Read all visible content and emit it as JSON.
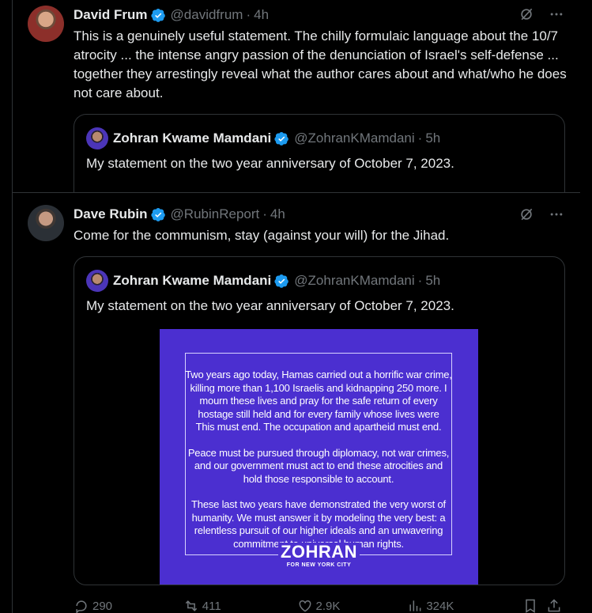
{
  "posts": [
    {
      "author": "David Frum",
      "handle": "@davidfrum",
      "time": "4h",
      "text": "This is a genuinely useful statement. The chilly formulaic language about the 10/7 atrocity ... the intense angry passion of the denunciation of Israel's self-defense ... together they arrestingly reveal what the author cares about and what/who he does not care about.",
      "quote": {
        "author": "Zohran Kwame Mamdani",
        "handle": "@ZohranKMamdani",
        "time": "5h",
        "text": "My statement on the two year anniversary of October 7, 2023."
      }
    },
    {
      "author": "Dave Rubin",
      "handle": "@RubinReport",
      "time": "4h",
      "text": "Come for the communism, stay (against your will) for the Jihad.",
      "quote": {
        "author": "Zohran Kwame Mamdani",
        "handle": "@ZohranKMamdani",
        "time": "5h",
        "text": "My statement on the two year anniversary of October 7, 2023.",
        "media": {
          "paragraph1": "Two years ago today, Hamas carried out a horrific war crime, killing more than 1,100 Israelis and kidnapping 250 more. I mourn these lives and pray for the safe return of every hostage still held and for every family whose lives were",
          "overlap_line": "This must end. The occupation and apartheid must end.",
          "paragraph2": "Peace must be pursued through diplomacy, not war crimes, and our government must act to end these atrocities and hold those responsible to account.",
          "paragraph3": "These last two years have demonstrated the very worst of humanity. We must answer it by modeling the very best: a relentless pursuit of our higher ideals and an unwavering commitment to universal human rights.",
          "logo_word": "ZOHRAN",
          "logo_sub": "FOR NEW YORK CITY",
          "background": "#4b2fd0"
        }
      },
      "stats": {
        "replies": "290",
        "reposts": "411",
        "likes": "2.9K",
        "views": "324K"
      }
    }
  ],
  "colors": {
    "background": "#000000",
    "text": "#e7e9ea",
    "muted": "#71767b",
    "border": "#2f3336",
    "verified": "#1d9bf0"
  },
  "icons": [
    "verified-badge-icon",
    "grok-icon",
    "more-icon",
    "reply-icon",
    "repost-icon",
    "like-icon",
    "views-icon",
    "bookmark-icon",
    "share-icon"
  ]
}
